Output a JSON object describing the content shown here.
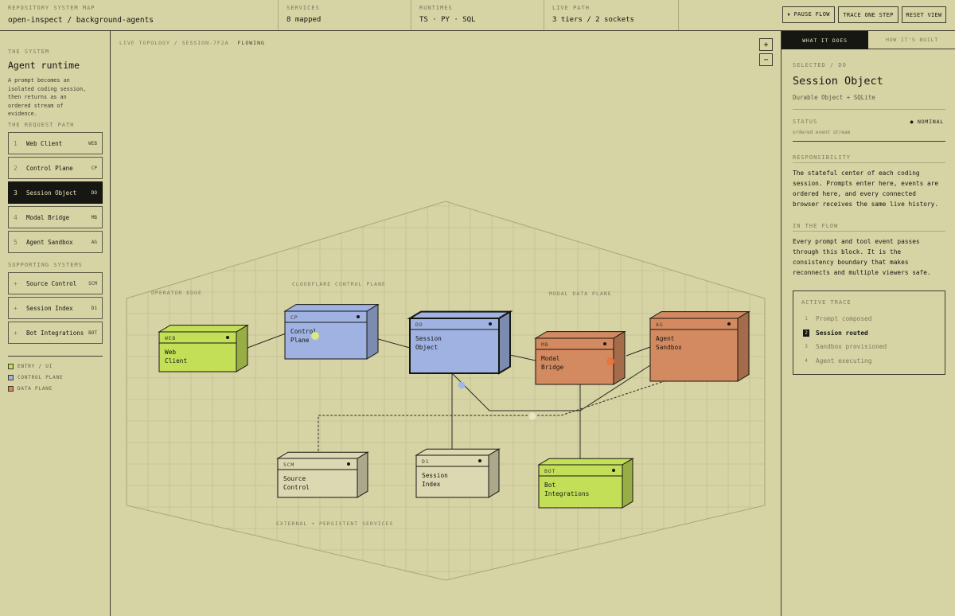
{
  "topbar": {
    "repo_label": "REPOSITORY SYSTEM MAP",
    "repo_value": "open-inspect / background-agents",
    "services_label": "SERVICES",
    "services_value": "8 mapped",
    "runtimes_label": "RUNTIMES",
    "runtimes_value": "TS · PY · SQL",
    "livepath_label": "LIVE PATH",
    "livepath_value": "3 tiers / 2 sockets",
    "btn_pause": "⏸ PAUSE FLOW",
    "btn_trace": "TRACE ONE STEP",
    "btn_reset": "RESET VIEW"
  },
  "left": {
    "system_label": "THE SYSTEM",
    "title": "Agent runtime",
    "description": "A prompt becomes an isolated coding session, then returns as an ordered stream of evidence.",
    "request_path_label": "THE REQUEST PATH",
    "request_path": [
      {
        "num": "1",
        "name": "Web Client",
        "code": "WEB"
      },
      {
        "num": "2",
        "name": "Control Plane",
        "code": "CP"
      },
      {
        "num": "3",
        "name": "Session Object",
        "code": "DO"
      },
      {
        "num": "4",
        "name": "Modal Bridge",
        "code": "MB"
      },
      {
        "num": "5",
        "name": "Agent Sandbox",
        "code": "AG"
      }
    ],
    "supporting_label": "SUPPORTING SYSTEMS",
    "supporting": [
      {
        "num": "+",
        "name": "Source Control",
        "code": "SCM"
      },
      {
        "num": "+",
        "name": "Session Index",
        "code": "D1"
      },
      {
        "num": "+",
        "name": "Bot Integrations",
        "code": "BOT"
      }
    ],
    "legend": [
      {
        "label": "ENTRY / UI",
        "color": "#c3df58"
      },
      {
        "label": "CONTROL PLANE",
        "color": "#9fb2e2"
      },
      {
        "label": "DATA PLANE",
        "color": "#d48a60"
      }
    ]
  },
  "canvas": {
    "crumb_a": "LIVE TOPOLOGY / SESSION-7F2A",
    "crumb_b": "FLOWING",
    "zoom_in": "+",
    "zoom_out": "−",
    "zones": {
      "operator": "OPERATOR EDGE",
      "cloudflare": "CLOUDFLARE CONTROL PLANE",
      "modal": "MODAL DATA PLANE",
      "external": "EXTERNAL + PERSISTENT SERVICES"
    },
    "nodes": {
      "web": {
        "code": "WEB",
        "line1": "Web",
        "line2": "Client"
      },
      "cp": {
        "code": "CP",
        "line1": "Control",
        "line2": "Plane"
      },
      "do": {
        "code": "DO",
        "line1": "Session",
        "line2": "Object"
      },
      "mb": {
        "code": "MB",
        "line1": "Modal",
        "line2": "Bridge"
      },
      "ag": {
        "code": "AG",
        "line1": "Agent",
        "line2": "Sandbox"
      },
      "scm": {
        "code": "SCM",
        "line1": "Source",
        "line2": "Control"
      },
      "d1": {
        "code": "D1",
        "line1": "Session",
        "line2": "Index"
      },
      "bot": {
        "code": "BOT",
        "line1": "Bot",
        "line2": "Integrations"
      }
    }
  },
  "right": {
    "tab_what": "WHAT IT DOES",
    "tab_how": "HOW IT'S BUILT",
    "selected_label": "SELECTED / DO",
    "title": "Session Object",
    "subtitle": "Durable Object + SQLite",
    "status_label": "STATUS",
    "status_value": "● NOMINAL",
    "status_note": "ordered event stream",
    "resp_label": "RESPONSIBILITY",
    "resp_text": "The stateful center of each coding session. Prompts enter here, events are ordered here, and every connected browser receives the same live history.",
    "flow_label": "IN THE FLOW",
    "flow_text": "Every prompt and tool event passes through this block. It is the consistency boundary that makes reconnects and multiple viewers safe.",
    "trace_label": "ACTIVE TRACE",
    "trace": [
      {
        "num": "1",
        "label": "Prompt composed"
      },
      {
        "num": "2",
        "label": "Session routed"
      },
      {
        "num": "3",
        "label": "Sandbox provisioned"
      },
      {
        "num": "4",
        "label": "Agent executing"
      }
    ],
    "trace_active": 1
  },
  "colors": {
    "entry": "#c3df58",
    "control": "#9fb2e2",
    "data": "#d48a60",
    "neutral": "#dcd8b2",
    "bg": "#d6d3a4",
    "ink": "#161612"
  }
}
